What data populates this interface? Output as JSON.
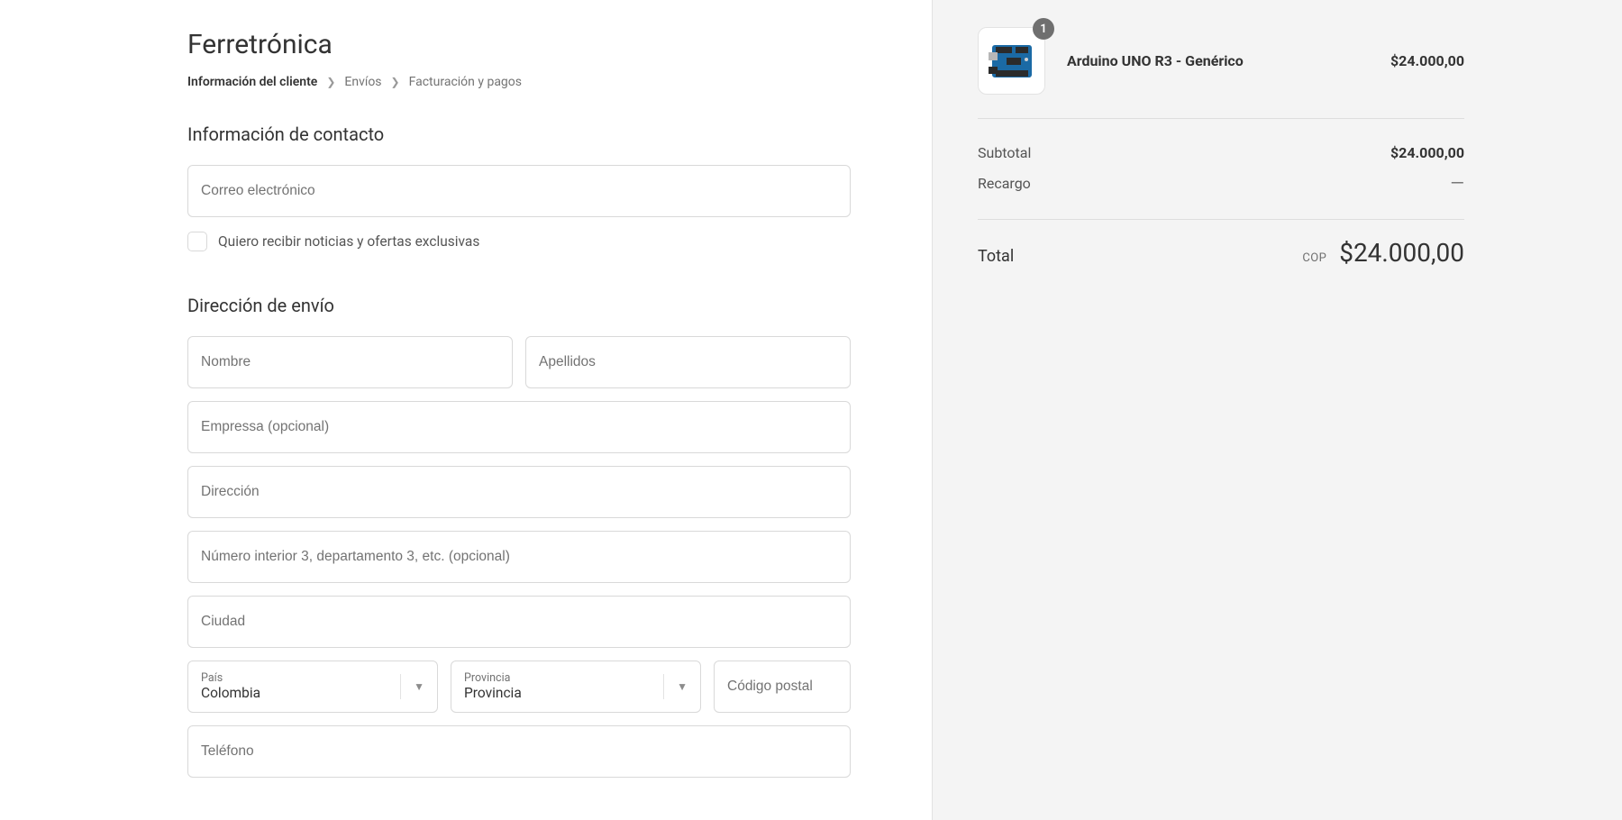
{
  "store": {
    "name": "Ferretrónica"
  },
  "breadcrumb": {
    "step1": "Información del cliente",
    "step2": "Envíos",
    "step3": "Facturación y pagos"
  },
  "contact": {
    "heading": "Información de contacto",
    "email_placeholder": "Correo electrónico",
    "newsletter_label": "Quiero recibir noticias y ofertas exclusivas"
  },
  "shipping": {
    "heading": "Dirección de envío",
    "first_name_placeholder": "Nombre",
    "last_name_placeholder": "Apellidos",
    "company_placeholder": "Empressa (opcional)",
    "address_placeholder": "Dirección",
    "address2_placeholder": "Número interior 3, departamento 3, etc. (opcional)",
    "city_placeholder": "Ciudad",
    "country_label": "País",
    "country_value": "Colombia",
    "province_label": "Provincia",
    "province_value": "Provincia",
    "postal_placeholder": "Código postal",
    "phone_placeholder": "Teléfono"
  },
  "cart": {
    "items": [
      {
        "name": "Arduino UNO R3 - Genérico",
        "qty": "1",
        "price": "$24.000,00"
      }
    ]
  },
  "summary": {
    "subtotal_label": "Subtotal",
    "subtotal_value": "$24.000,00",
    "surcharge_label": "Recargo",
    "surcharge_value": "—",
    "total_label": "Total",
    "currency": "COP",
    "total_value": "$24.000,00"
  }
}
